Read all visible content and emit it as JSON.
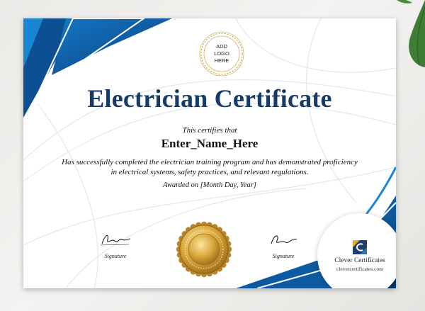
{
  "logo": {
    "line1": "ADD",
    "line2": "LOGO",
    "line3": "HERE"
  },
  "certificate": {
    "title": "Electrician Certificate",
    "certifies": "This certifies that",
    "recipient": "Enter_Name_Here",
    "description_line1": "Has successfully completed the electrician training program and has demonstrated proficiency",
    "description_line2": "in electrical systems, safety practices, and relevant regulations.",
    "awarded": "Awarded on [Month Day, Year]"
  },
  "signatures": {
    "left_label": "Signature",
    "right_label": "Signature"
  },
  "brand_badge": {
    "name": "Clever Certificates",
    "url": "clevercertificates.com"
  },
  "colors": {
    "title": "#173a66",
    "accent_blue": "#0d5aa0",
    "dark_blue": "#0a3f7a",
    "gold": "#c9962e"
  }
}
